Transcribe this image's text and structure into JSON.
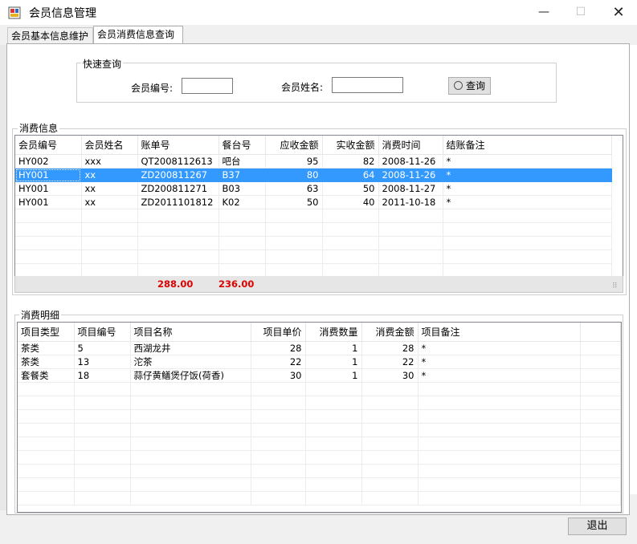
{
  "window": {
    "title": "会员信息管理"
  },
  "tabs": [
    {
      "label": "会员基本信息维护"
    },
    {
      "label": "会员消费信息查询"
    }
  ],
  "quick_query": {
    "title": "快速查询",
    "member_id_label": "会员编号:",
    "member_id_value": "",
    "member_name_label": "会员姓名:",
    "member_name_value": "",
    "query_button": "查询"
  },
  "consumption": {
    "title": "消费信息",
    "columns": [
      "会员编号",
      "会员姓名",
      "账单号",
      "餐台号",
      "应收金额",
      "实收金额",
      "消费时间",
      "结账备注"
    ],
    "rows": [
      [
        "HY002",
        "xxx",
        "QT2008112613",
        "吧台",
        "95",
        "82",
        "2008-11-26",
        "*"
      ],
      [
        "HY001",
        "xx",
        "ZD200811267",
        "B37",
        "80",
        "64",
        "2008-11-26",
        "*"
      ],
      [
        "HY001",
        "xx",
        "ZD200811271",
        "B03",
        "63",
        "50",
        "2008-11-27",
        "*"
      ],
      [
        "HY001",
        "xx",
        "ZD2011101812",
        "K02",
        "50",
        "40",
        "2011-10-18",
        "*"
      ]
    ],
    "selected_row": 1,
    "total_receivable": "288.00",
    "total_received": "236.00"
  },
  "details": {
    "title": "消费明细",
    "columns": [
      "项目类型",
      "项目编号",
      "项目名称",
      "项目单价",
      "消费数量",
      "消费金额",
      "项目备注"
    ],
    "rows": [
      [
        "茶类",
        "5",
        "西湖龙井",
        "28",
        "1",
        "28",
        "*"
      ],
      [
        "茶类",
        "13",
        "沱茶",
        "22",
        "1",
        "22",
        "*"
      ],
      [
        "套餐类",
        "18",
        "蒜仔黄鳝煲仔饭(荷香)",
        "30",
        "1",
        "30",
        "*"
      ]
    ]
  },
  "exit_button": "退出",
  "colors": {
    "selection": "#3399ff",
    "total_text": "#e00000"
  }
}
